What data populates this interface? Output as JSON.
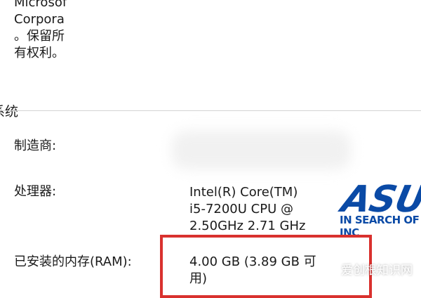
{
  "copyright": {
    "lines": [
      "Microsof",
      "Corpora",
      "。保留所",
      "有权利。"
    ]
  },
  "section": {
    "title": "系统"
  },
  "system": {
    "manufacturer_label": "制造商:",
    "processor_label": "处理器:",
    "processor_value_lines": [
      "Intel(R) Core(TM)",
      "i5-7200U CPU @",
      "2.50GHz   2.71 GHz"
    ],
    "ram_label": "已安装的内存(RAM):",
    "ram_value_lines": [
      "4.00 GB (3.89 GB 可",
      "用)"
    ]
  },
  "logo": {
    "name": "ASUS",
    "tagline": "IN SEARCH OF INC"
  },
  "watermark": {
    "text": "爱创根知识网"
  },
  "colors": {
    "highlight": "#d9312e",
    "logo": "#0a4aa6"
  }
}
